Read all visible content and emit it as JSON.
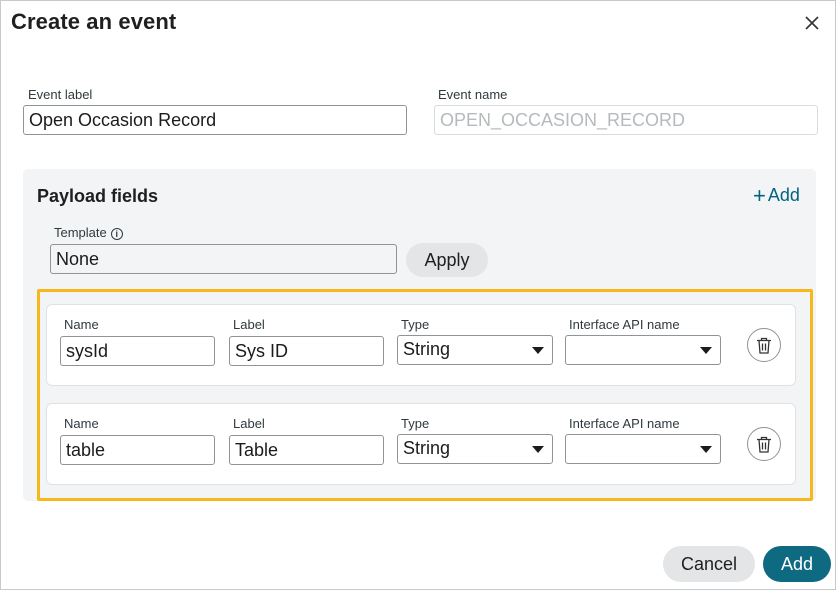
{
  "dialog": {
    "title": "Create an event",
    "close_icon": "close-icon"
  },
  "event": {
    "label_caption": "Event label",
    "label_value": "Open Occasion Record",
    "name_caption": "Event name",
    "name_value": "OPEN_OCCASION_RECORD"
  },
  "payload": {
    "title": "Payload fields",
    "add_label": "Add",
    "template_caption": "Template",
    "template_value": "None",
    "apply_label": "Apply",
    "highlight_color": "#f6b81a",
    "fields": [
      {
        "name_caption": "Name",
        "name_value": "sysId",
        "label_caption": "Label",
        "label_value": "Sys ID",
        "type_caption": "Type",
        "type_value": "String",
        "api_caption": "Interface API name",
        "api_value": ""
      },
      {
        "name_caption": "Name",
        "name_value": "table",
        "label_caption": "Label",
        "label_value": "Table",
        "type_caption": "Type",
        "type_value": "String",
        "api_caption": "Interface API name",
        "api_value": ""
      }
    ]
  },
  "footer": {
    "cancel_label": "Cancel",
    "add_label": "Add",
    "primary_color": "#0e6a80"
  }
}
